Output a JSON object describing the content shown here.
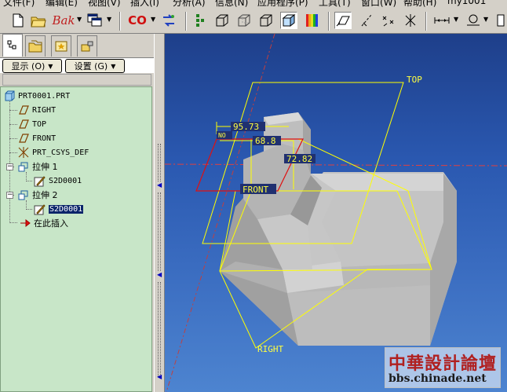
{
  "menu": {
    "items": [
      "文件(F)",
      "编辑(E)",
      "视图(V)",
      "插入(I)",
      "分析(A)",
      "信息(N)",
      "应用程序(P)",
      "工具(T)",
      "窗口(W)",
      "帮助(H)",
      "my1001"
    ]
  },
  "toolbar": {
    "bak_label": "Bak",
    "co_label": "CO"
  },
  "left_panel": {
    "show_button": "显示 (O)",
    "settings_button": "设置 (G)",
    "tree": [
      {
        "label": "PRT0001.PRT"
      },
      {
        "label": "RIGHT"
      },
      {
        "label": "TOP"
      },
      {
        "label": "FRONT"
      },
      {
        "label": "PRT_CSYS_DEF"
      },
      {
        "label": "拉伸 1"
      },
      {
        "label": "S2D0001"
      },
      {
        "label": "拉伸 2"
      },
      {
        "label": "S2D0001"
      },
      {
        "label": "在此插入"
      }
    ]
  },
  "viewport": {
    "datum_top": "TOP",
    "datum_front": "FRONT",
    "datum_right": "RIGHT",
    "dim1": "95.73",
    "dim2": "68.8",
    "dim3": "72.82",
    "dim_small": "NO"
  },
  "watermark": {
    "title": "中華設計論壇",
    "url": "bbs.chinade.net"
  },
  "colors": {
    "tree_bg": "#c8e6c8",
    "viewport_top": "#1e3f8a",
    "viewport_bottom": "#4d84d0",
    "datum_yellow": "#ffff00",
    "sketch_red": "#e01010",
    "selection": "#0a246a"
  }
}
